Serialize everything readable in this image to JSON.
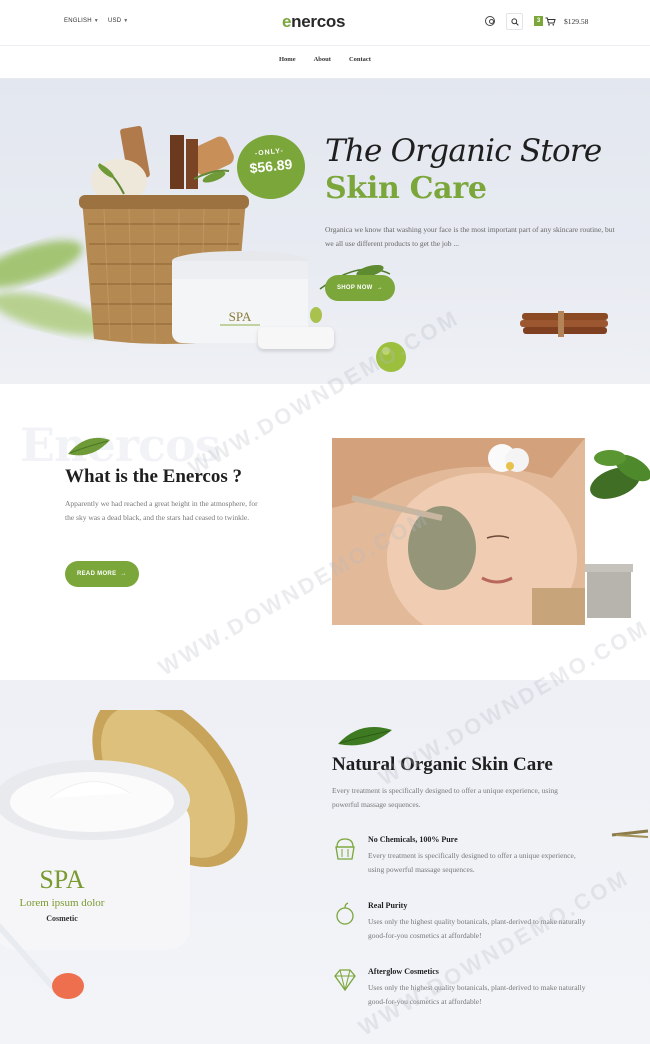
{
  "header": {
    "language": "ENGLISH",
    "currency": "USD",
    "logo_accent": "e",
    "logo_rest": "nercos",
    "cart_count": "3",
    "cart_total": "$129.58"
  },
  "nav": {
    "items": [
      "Home",
      "About",
      "Contact"
    ]
  },
  "hero": {
    "title": "The Organic Store",
    "subtitle": "Skin Care",
    "description": "Organica we know that washing your face is the most important part of any skincare routine, but we all use different products to get the job ...",
    "button_label": "SHOP NOW",
    "badge_label": "-ONLY-",
    "badge_price": "$56.89",
    "jar_label": "SPA"
  },
  "about": {
    "ghost_text": "Enercos",
    "title": "What is the Enercos ?",
    "text": "Apparently we had reached a great height in the atmosphere, for the sky was a dead black, and the stars had ceased to twinkle.",
    "button_label": "READ MORE"
  },
  "features": {
    "title": "Natural Organic Skin Care",
    "description": "Every treatment is specifically designed to offer a unique experience, using powerful massage sequences.",
    "items": [
      {
        "title": "No Chemicals, 100% Pure",
        "text": "Every treatment is specifically designed to offer a unique experience, using powerful massage sequences.",
        "icon": "cupcake-icon"
      },
      {
        "title": "Real Purity",
        "text": "Uses only the highest quality botanicals, plant-derived to make naturally good-for-you cosmetics at affordable!",
        "icon": "apple-icon"
      },
      {
        "title": "Afterglow Cosmetics",
        "text": "Uses only the highest quality botanicals, plant-derived to make naturally good-for-you cosmetics at affordable!",
        "icon": "diamond-icon"
      }
    ],
    "jar_brand": "SPA",
    "jar_tagline": "Lorem ipsum dolor",
    "jar_type": "Cosmetic"
  },
  "watermark": "WWW.DOWNDEMO.COM",
  "colors": {
    "accent": "#7aa63a",
    "hero_bg": "#e3e7ef",
    "text": "#1f1f1f"
  }
}
